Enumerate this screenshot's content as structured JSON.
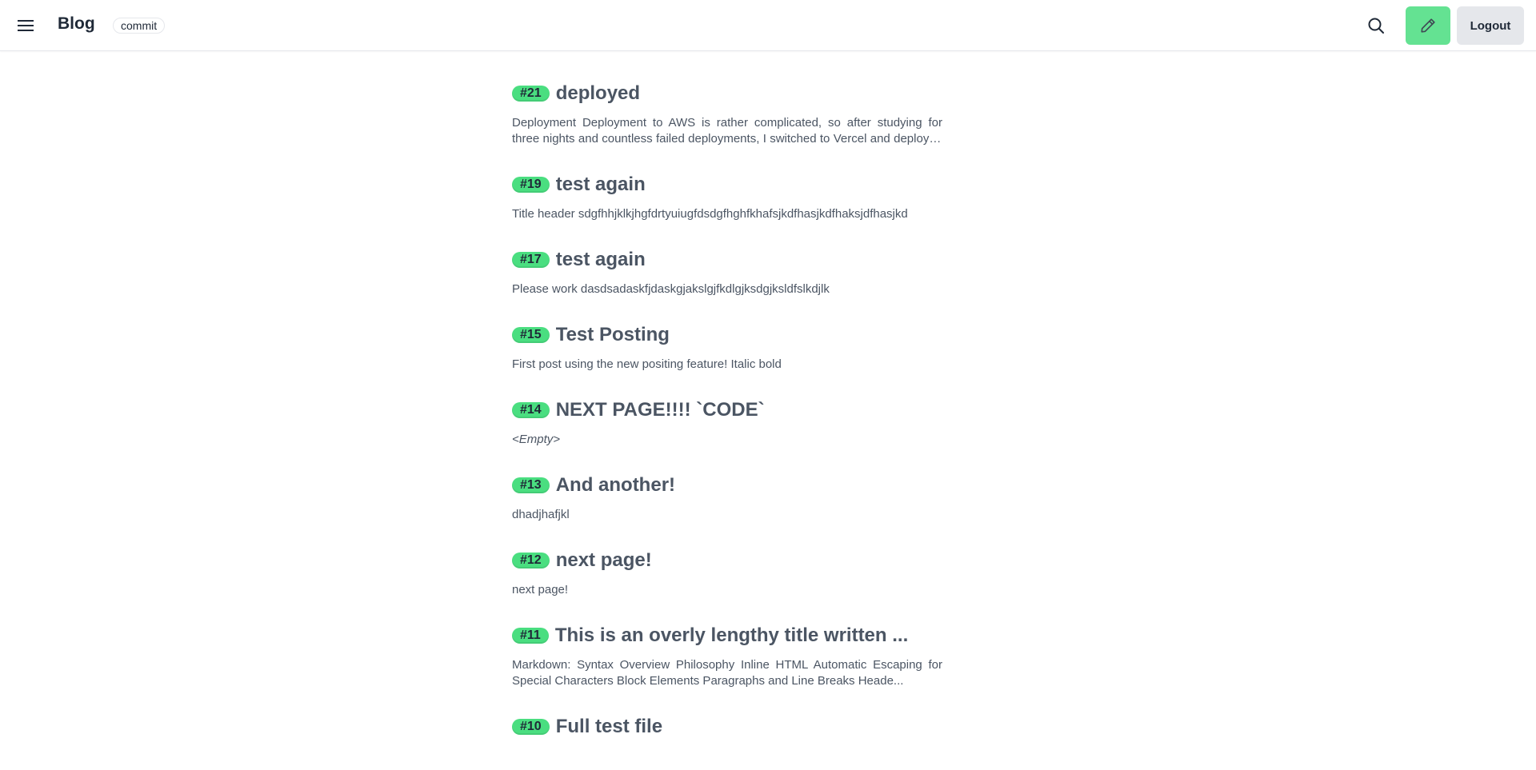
{
  "header": {
    "brand": "Blog",
    "badge": "commit",
    "logout_label": "Logout"
  },
  "icons": {
    "menu": "hamburger-menu-icon",
    "search": "search-icon",
    "write": "pencil-icon"
  },
  "colors": {
    "accent_green": "#4ade80",
    "button_gray": "#e5e7eb"
  },
  "posts": [
    {
      "id": "#21",
      "title": "deployed",
      "excerpt": "Deployment Deployment to AWS is rather complicated, so after studying for three nights and countless failed deployments, I switched to Vercel and deployed t..."
    },
    {
      "id": "#19",
      "title": "test again",
      "excerpt": "Title header sdgfhhjklkjhgfdrtyuiugfdsdgfhghfkhafsjkdfhasjkdfhaksjdfhasjkd"
    },
    {
      "id": "#17",
      "title": "test again",
      "excerpt": "Please work dasdsadaskfjdaskgjakslgjfkdlgjksdgjksldfslkdjlk"
    },
    {
      "id": "#15",
      "title": "Test Posting",
      "excerpt": "First post using the new positing feature! Italic bold"
    },
    {
      "id": "#14",
      "title": "NEXT PAGE!!!! `CODE`",
      "excerpt": "<Empty>"
    },
    {
      "id": "#13",
      "title": "And another!",
      "excerpt": "dhadjhafjkl"
    },
    {
      "id": "#12",
      "title": "next page!",
      "excerpt": "next page!"
    },
    {
      "id": "#11",
      "title": "This is an overly lengthy title written ...",
      "excerpt": "Markdown: Syntax Overview Philosophy Inline HTML Automatic Escaping for Special Characters Block Elements Paragraphs and Line Breaks Heade..."
    },
    {
      "id": "#10",
      "title": "Full test file",
      "excerpt": ""
    }
  ]
}
